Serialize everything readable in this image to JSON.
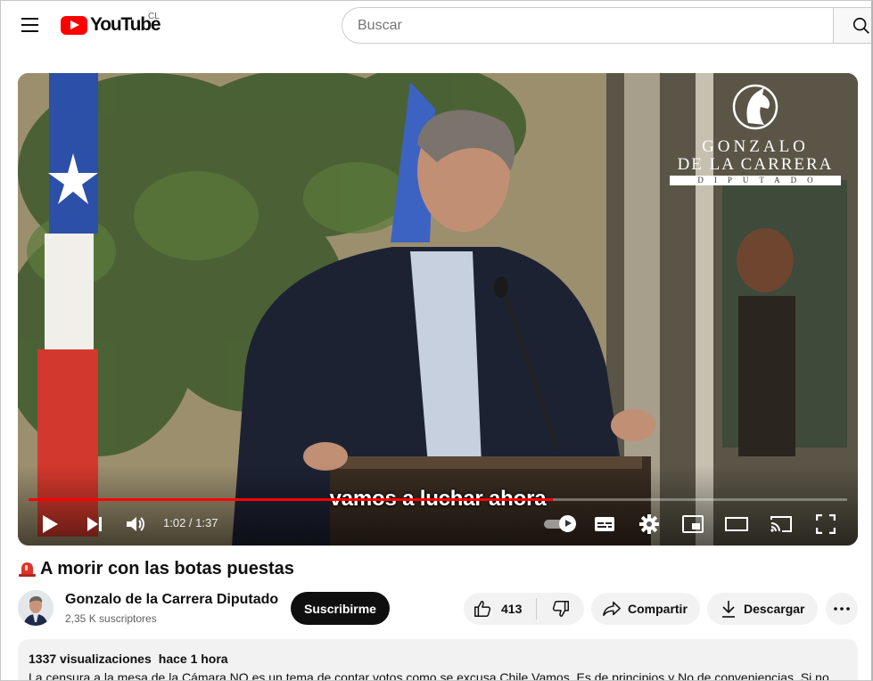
{
  "header": {
    "logo_text": "YouTube",
    "country_code": "CL",
    "search_placeholder": "Buscar"
  },
  "player": {
    "watermark": {
      "line1": "GONZALO",
      "line2": "DE LA CARRERA",
      "line3": "DIPUTADO"
    },
    "caption": "vamos a luchar ahora",
    "current_time": "1:02",
    "duration": "1:37",
    "time_display": "1:02 / 1:37",
    "progress_fraction": 0.64,
    "autoplay_on": true,
    "progress_color": "#ff0000"
  },
  "video": {
    "title": "A morir con las botas puestas",
    "title_icon": "police-siren-icon"
  },
  "channel": {
    "name": "Gonzalo de la Carrera Diputado",
    "subscribers": "2,35 K suscriptores",
    "subscribe_label": "Suscribirme"
  },
  "actions": {
    "like_count": "413",
    "share_label": "Compartir",
    "download_label": "Descargar"
  },
  "description": {
    "views": "1337 visualizaciones",
    "posted": "hace 1 hora",
    "text": "La censura a la mesa de la Cámara NO es un tema de contar votos como se excusa Chile Vamos. Es de principios y No de conveniencias. Si no"
  }
}
